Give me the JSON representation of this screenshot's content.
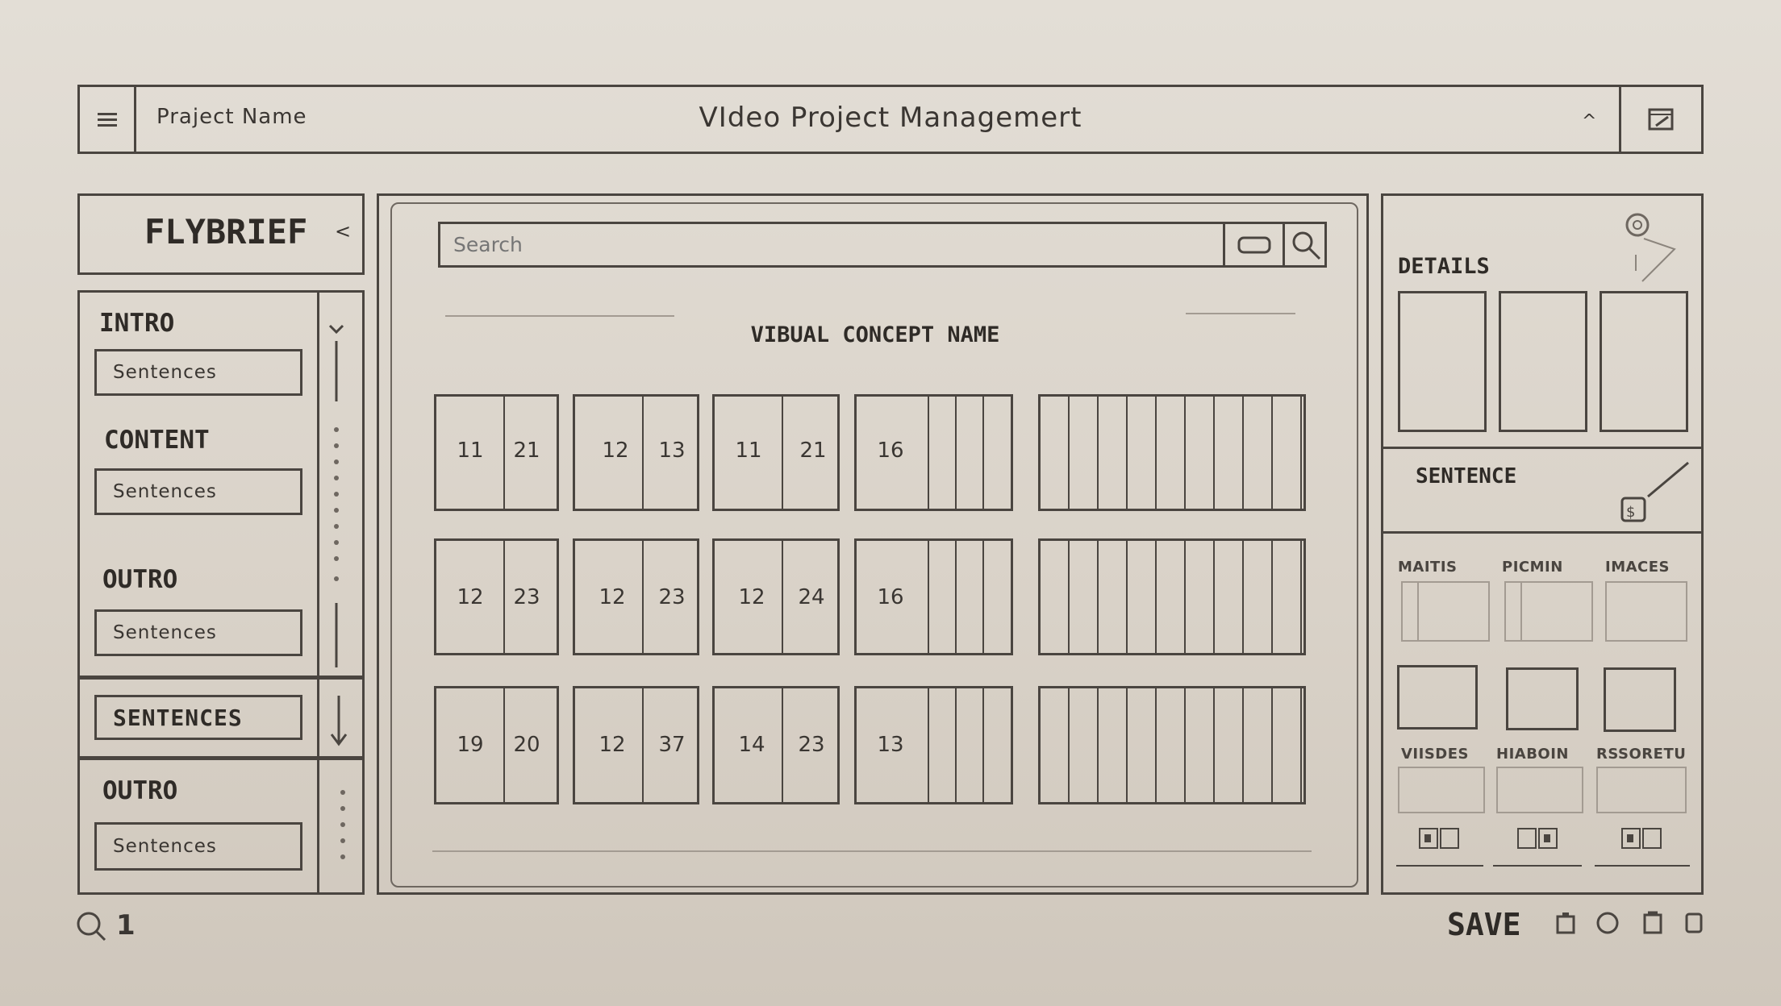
{
  "header": {
    "project_name": "Praject Name",
    "title": "VIdeo Project Managemert",
    "caret": "^"
  },
  "sidebar": {
    "brand": "FLYBRIEF",
    "collapse": "<",
    "sections": [
      {
        "heading": "INTRO",
        "field": "Sentences"
      },
      {
        "heading": "CONTENT",
        "field": "Sentences"
      },
      {
        "heading": "OUTRO",
        "field": "Sentences"
      }
    ],
    "sentences_label": "SENTENCES",
    "outro2": {
      "heading": "OUTRO",
      "field": "Sentences"
    }
  },
  "main": {
    "search_placeholder": "Search",
    "concept_title": "VIBUAL CONCEPT NAME",
    "grid": [
      [
        [
          "11",
          "21"
        ],
        [
          "12",
          "13"
        ],
        [
          "11",
          "21"
        ],
        [
          "16"
        ]
      ],
      [
        [
          "12",
          "23"
        ],
        [
          "12",
          "23"
        ],
        [
          "12",
          "24"
        ],
        [
          "16"
        ]
      ],
      [
        [
          "19",
          "20"
        ],
        [
          "12",
          "37"
        ],
        [
          "14",
          "23"
        ],
        [
          "13"
        ]
      ]
    ]
  },
  "details": {
    "title": "DETAILS",
    "sentence_label": "SENTENCE",
    "media_labels_top": [
      "MAITIS",
      "PICMIN",
      "IMACES"
    ],
    "media_labels_bottom": [
      "VIISDES",
      "HIABOIN",
      "RSSORETU"
    ]
  },
  "footer": {
    "page_number": "1",
    "save_label": "SAVE"
  }
}
